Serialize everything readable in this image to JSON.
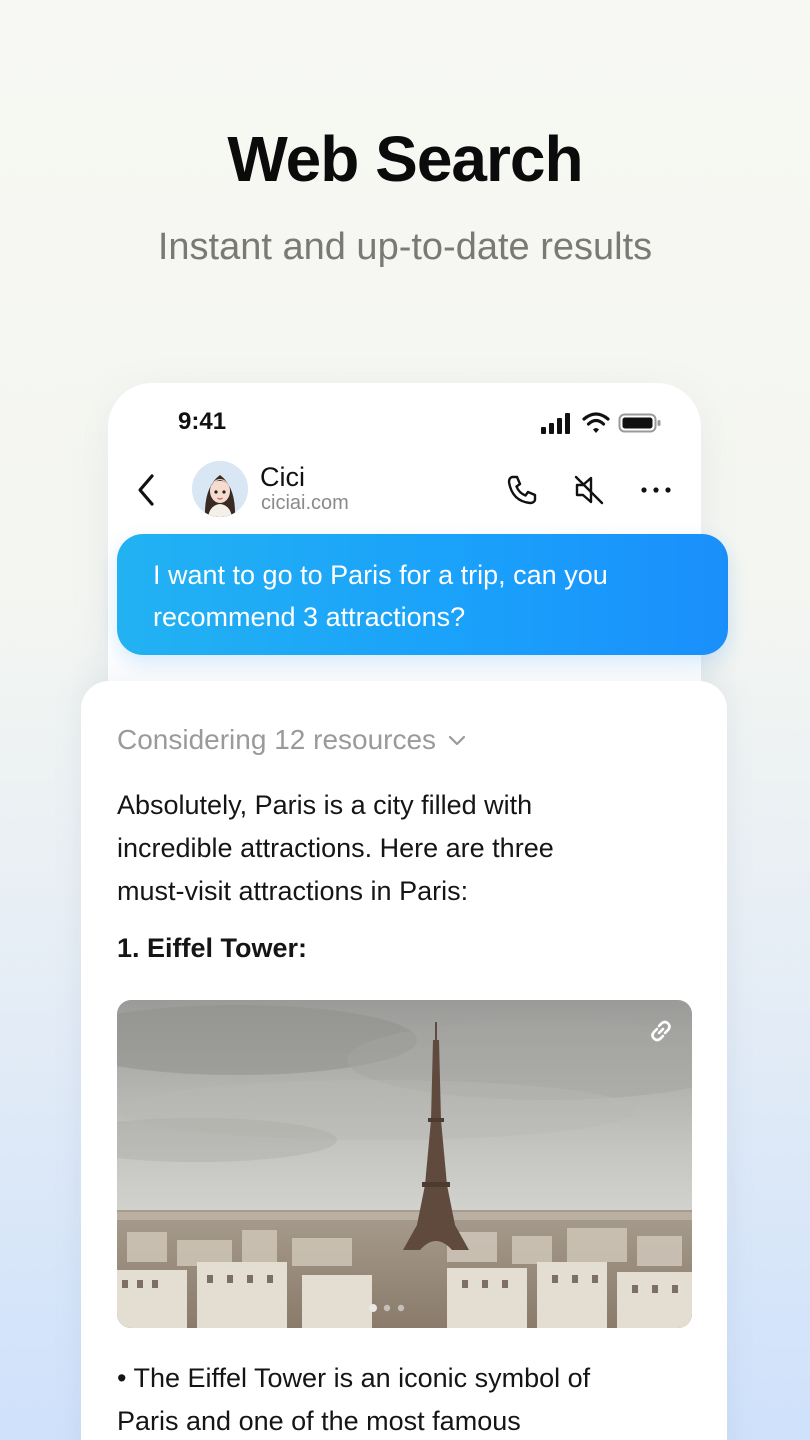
{
  "promo": {
    "headline": "Web Search",
    "subheadline": "Instant and up-to-date results"
  },
  "status_bar": {
    "time": "9:41",
    "icons": [
      "cellular-signal-icon",
      "wifi-icon",
      "battery-icon"
    ]
  },
  "chat_header": {
    "contact_name": "Cici",
    "contact_domain": "ciciai.com",
    "actions": [
      "phone-icon",
      "mute-icon",
      "more-icon"
    ]
  },
  "user_message": {
    "line1": "I want to go to Paris for a trip, can you",
    "line2": "recommend 3 attractions?"
  },
  "assistant_reply": {
    "sources_label": "Considering 12 resources",
    "intro_line1": "Absolutely, Paris is a city filled with",
    "intro_line2": "incredible attractions. Here are three",
    "intro_line3": "must-visit attractions in Paris:",
    "item1_title": "1. Eiffel Tower:",
    "image_icon": "link-icon",
    "image_pages": 3,
    "image_current_page": 1,
    "bullet_line1": "• The Eiffel Tower is an iconic symbol of",
    "bullet_line2": "Paris and one of the most famous"
  },
  "colors": {
    "bubble_start": "#22b2f2",
    "bubble_end": "#1a8ffb",
    "muted_text": "#9a9a9a"
  }
}
